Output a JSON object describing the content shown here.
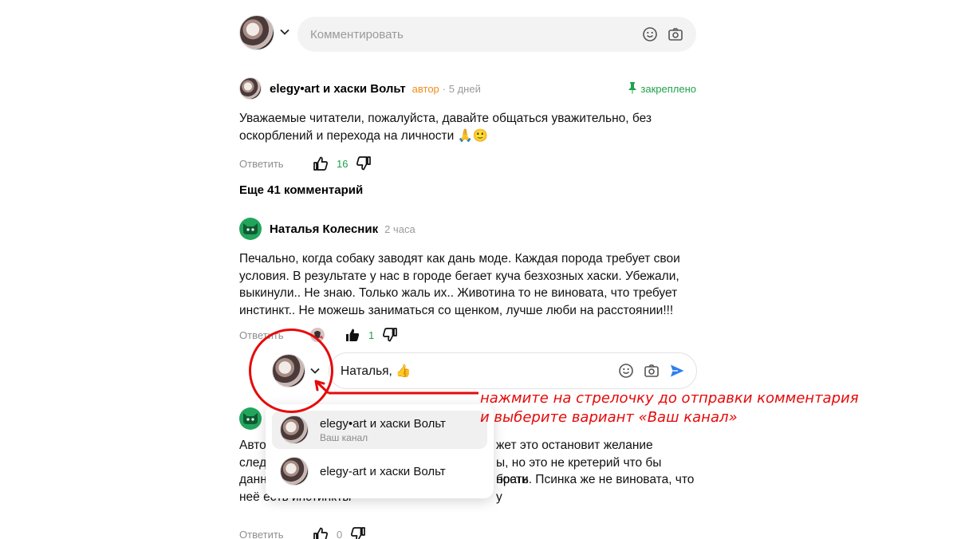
{
  "top_input": {
    "placeholder": "Комментировать"
  },
  "pinned_comment": {
    "author": "elegy•art и хаски Вольт",
    "role": "автор",
    "time": "· 5 дней",
    "pinned_label": "закреплено",
    "text": "Уважаемые читатели, пожалуйста, давайте общаться уважительно, без оскорблений и перехода на личности 🙏🙂",
    "reply_label": "Ответить",
    "likes": "16"
  },
  "more_comments_label": "Еще 41 комментарий",
  "comment_2": {
    "author": "Наталья Колесник",
    "time": "2 часа",
    "text": "Печально, когда собаку заводят как дань моде. Каждая порода требует свои условия. В результате у нас в городе бегает куча безхозных хаски. Убежали, выкинули.. Не знаю. Только жаль их.. Животина то не виновата, что требует инстинкт.. Не можешь заниматься со щенком, лучше люби на расстоянии!!!",
    "reply_label": "Ответить",
    "likes": "1"
  },
  "reply_input": {
    "value": "Наталья, 👍"
  },
  "dropdown": {
    "items": [
      {
        "name": "elegy•art и хаски Вольт",
        "sub": "Ваш канал"
      },
      {
        "name": "elegy-art и хаски Вольт",
        "sub": ""
      }
    ]
  },
  "comment_3": {
    "line1_left": "Авто",
    "line1_right": "жет это остановит желание",
    "line2_left": "след",
    "line2_right": "ы, но это не кретерий что бы брать",
    "line3_left": "данн",
    "line3_right": "ности. Псинка же не виновата, что у",
    "line4": "неё есть инстинкты",
    "reply_label": "Ответить",
    "likes": "0"
  },
  "annotation": {
    "line1": "нажмите на стрелочку до отправки комментария",
    "line2": "и выберите вариант «Ваш канал»"
  },
  "colors": {
    "accent_green": "#1fa24b",
    "author_orange": "#f08c1a",
    "annotation_red": "#e60a0a",
    "send_blue": "#2f80ed"
  }
}
